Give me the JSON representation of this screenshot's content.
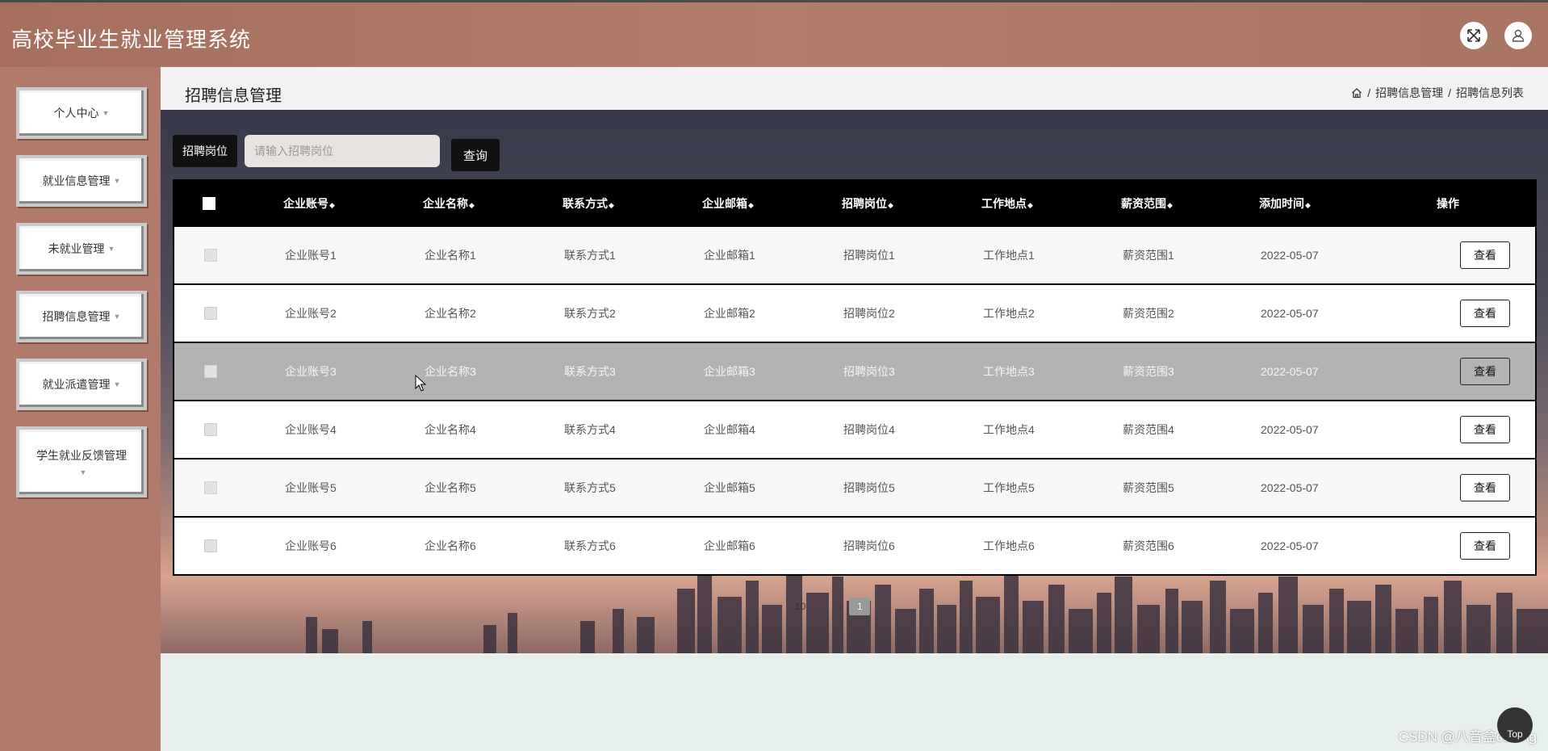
{
  "app": {
    "title": "高校毕业生就业管理系统"
  },
  "header": {
    "fullscreen_icon": "expand-icon",
    "user_icon": "user-icon"
  },
  "sidebar": {
    "items": [
      {
        "label": "个人中心"
      },
      {
        "label": "就业信息管理"
      },
      {
        "label": "未就业管理"
      },
      {
        "label": "招聘信息管理"
      },
      {
        "label": "就业派遣管理"
      },
      {
        "label": "学生就业反馈管理"
      }
    ]
  },
  "page": {
    "title": "招聘信息管理",
    "breadcrumb": [
      "招聘信息管理",
      "招聘信息列表"
    ]
  },
  "search": {
    "label": "招聘岗位",
    "placeholder": "请输入招聘岗位",
    "value": "",
    "button": "查询"
  },
  "table": {
    "columns": [
      "企业账号",
      "企业名称",
      "联系方式",
      "企业邮箱",
      "招聘岗位",
      "工作地点",
      "薪资范围",
      "添加时间",
      "操作"
    ],
    "rows": [
      [
        "企业账号1",
        "企业名称1",
        "联系方式1",
        "企业邮箱1",
        "招聘岗位1",
        "工作地点1",
        "薪资范围1",
        "2022-05-07"
      ],
      [
        "企业账号2",
        "企业名称2",
        "联系方式2",
        "企业邮箱2",
        "招聘岗位2",
        "工作地点2",
        "薪资范围2",
        "2022-05-07"
      ],
      [
        "企业账号3",
        "企业名称3",
        "联系方式3",
        "企业邮箱3",
        "招聘岗位3",
        "工作地点3",
        "薪资范围3",
        "2022-05-07"
      ],
      [
        "企业账号4",
        "企业名称4",
        "联系方式4",
        "企业邮箱4",
        "招聘岗位4",
        "工作地点4",
        "薪资范围4",
        "2022-05-07"
      ],
      [
        "企业账号5",
        "企业名称5",
        "联系方式5",
        "企业邮箱5",
        "招聘岗位5",
        "工作地点5",
        "薪资范围5",
        "2022-05-07"
      ],
      [
        "企业账号6",
        "企业名称6",
        "联系方式6",
        "企业邮箱6",
        "招聘岗位6",
        "工作地点6",
        "薪资范围6",
        "2022-05-07"
      ]
    ],
    "action_label": "查看"
  },
  "pagination": {
    "page_size": "10",
    "current_page": "1"
  },
  "top_button": "Top",
  "watermark": "CSDN @八音盒coding"
}
